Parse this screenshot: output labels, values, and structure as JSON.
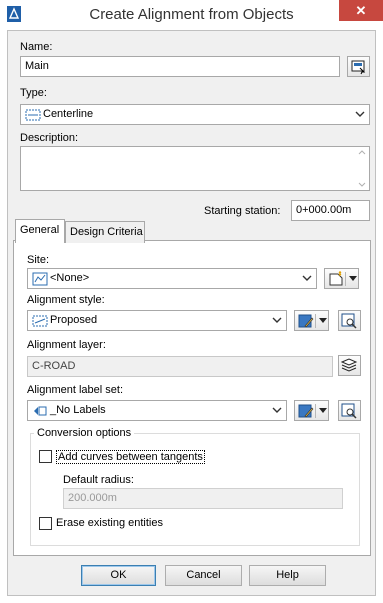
{
  "window": {
    "title": "Create Alignment from Objects",
    "close_glyph": "✕"
  },
  "name": {
    "label": "Name:",
    "value": "Main"
  },
  "type": {
    "label": "Type:",
    "value": "Centerline"
  },
  "description": {
    "label": "Description:",
    "value": ""
  },
  "starting_station": {
    "label": "Starting station:",
    "value": "0+000.00m"
  },
  "tabs": [
    {
      "label": "General",
      "active": true
    },
    {
      "label": "Design Criteria",
      "active": false
    }
  ],
  "general": {
    "site": {
      "label": "Site:",
      "value": "<None>"
    },
    "alignment_style": {
      "label": "Alignment style:",
      "value": "Proposed"
    },
    "alignment_layer": {
      "label": "Alignment layer:",
      "value": "C-ROAD"
    },
    "alignment_label_set": {
      "label": "Alignment label set:",
      "value": "_No Labels"
    },
    "conversion": {
      "title": "Conversion options",
      "add_curves": {
        "label": "Add curves between tangents",
        "checked": false
      },
      "default_radius": {
        "label": "Default radius:",
        "value": "200.000m"
      },
      "erase": {
        "label": "Erase existing entities",
        "checked": false
      }
    }
  },
  "buttons": {
    "ok": "OK",
    "cancel": "Cancel",
    "help": "Help"
  },
  "colors": {
    "close": "#c7483f",
    "dialog_bg": "#f0f0f0",
    "accent_blue": "#1f5fa8"
  }
}
